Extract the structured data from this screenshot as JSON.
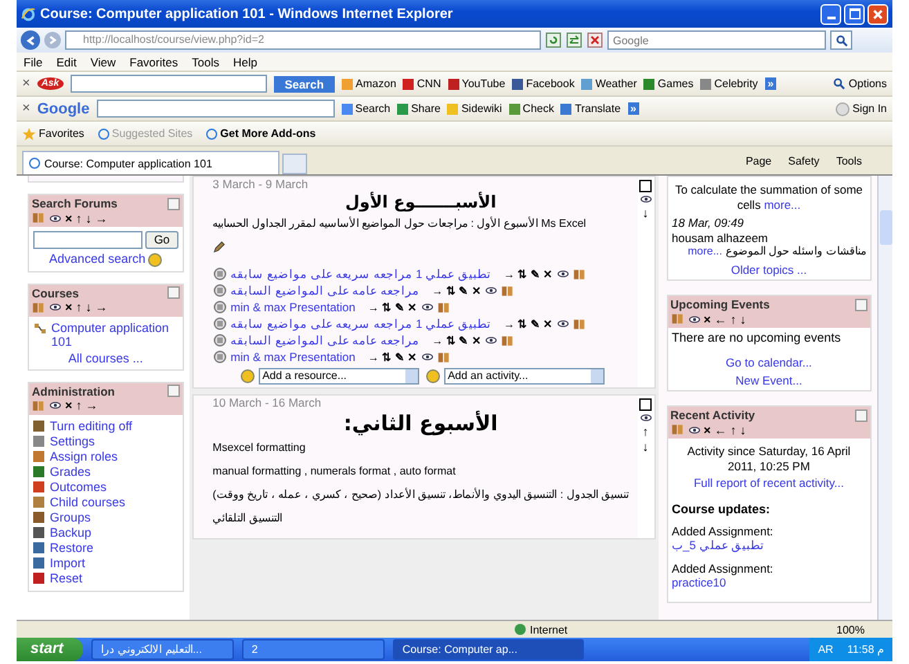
{
  "window": {
    "title": "Course: Computer application 101 - Windows Internet Explorer"
  },
  "address_bar": {
    "url": "http://localhost/course/view.php?id=2",
    "search_placeholder": "Google"
  },
  "menu": [
    "File",
    "Edit",
    "View",
    "Favorites",
    "Tools",
    "Help"
  ],
  "ask_toolbar": {
    "close": "×",
    "logo": "Ask",
    "search_button": "Search",
    "links": [
      "Amazon",
      "CNN",
      "YouTube",
      "Facebook",
      "Weather",
      "Games",
      "Celebrity"
    ],
    "more": "»",
    "options": "Options"
  },
  "google_toolbar": {
    "close": "×",
    "logo": "Google",
    "items": [
      "Search",
      "Share",
      "Sidewiki",
      "Check",
      "Translate"
    ],
    "more": "»",
    "sign_in": "Sign In"
  },
  "favorites_bar": {
    "favorites": "Favorites",
    "items": [
      {
        "label": "Suggested Sites",
        "disabled": true,
        "emphasis": false
      },
      {
        "label": "Get More Add-ons",
        "disabled": false,
        "emphasis": true
      }
    ]
  },
  "tab": {
    "title": "Course: Computer application 101",
    "selected": true
  },
  "command_bar": [
    "Page",
    "Safety",
    "Tools"
  ],
  "left_blocks": [
    {
      "title": "Search Forums",
      "kind": "search",
      "controls": "× ↑ ↓ →",
      "button": "Go",
      "link": "Advanced search"
    },
    {
      "title": "Courses",
      "kind": "courses",
      "controls": "× ↑ ↓ →",
      "items": [
        "Computer application 101"
      ],
      "footer": "All courses ..."
    },
    {
      "title": "Administration",
      "kind": "admin",
      "controls": "× ↑ →",
      "items": [
        "Turn editing off",
        "Settings",
        "Assign roles",
        "Grades",
        "Outcomes",
        "Child courses",
        "Groups",
        "Backup",
        "Restore",
        "Import",
        "Reset"
      ]
    }
  ],
  "sections": [
    {
      "dates": "3 March - 9 March",
      "heading": "الأسبـــــــوع الأول",
      "lines": [
        "الأسبوع الأول : مراجعات حول المواضيع الأساسيه لمقرر الجداول الحسابيه Ms Excel"
      ],
      "side_controls": "↓",
      "resources": [
        {
          "title": "تطبيق عملي 1 مراجعه سريعه على مواضيع سابقه",
          "controls": "→ ⇅ ✎ ✕"
        },
        {
          "title": "مراجعه عامه على المواضيع السابقه",
          "controls": "→ ⇅ ✎ ✕"
        },
        {
          "title": "min & max Presentation",
          "controls": "→ ⇅ ✎ ✕"
        },
        {
          "title": "تطبيق عملي 1 مراجعه سريعه على مواضيع سابقه",
          "controls": "→ ⇅ ✎ ✕"
        },
        {
          "title": "مراجعه عامه على المواضيع السابقه",
          "controls": "→ ⇅ ✎ ✕"
        },
        {
          "title": "min & max Presentation",
          "controls": "→ ⇅ ✎ ✕"
        }
      ],
      "add_resource": "Add a resource...",
      "add_activity": "Add an activity..."
    },
    {
      "dates": "10 March - 16 March",
      "heading": "الأسبوع الثاني:",
      "lines": [
        "Msexcel formatting",
        "manual formatting , numerals format , auto format",
        "تنسيق الجدول : التنسيق اليدوي والأنماط، تنسيق الأعداد (صحيح ، كسري ، عمله ، تاريخ ووقت)",
        "التنسيق التلقائي"
      ],
      "side_controls": "↑ ↓"
    }
  ],
  "forum_block": {
    "text": "To calculate the summation of some cells",
    "more": "more...",
    "date": "18 Mar, 09:49",
    "author": "housam alhazeem",
    "post": "مناقشات واسئله حول الموضوع",
    "post_more": "more...",
    "older": "Older topics ..."
  },
  "right_blocks": [
    {
      "title": "Upcoming Events",
      "kind": "events",
      "controls": "× ← ↑ ↓",
      "text": "There are no upcoming events",
      "links": [
        "Go to calendar...",
        "New Event..."
      ]
    },
    {
      "title": "Recent Activity",
      "kind": "activity",
      "controls": "× ← ↑ ↓",
      "text": "Activity since Saturday, 16 April 2011, 10:25 PM",
      "link": "Full report of recent activity...",
      "subheading": "Course updates:",
      "updates": [
        {
          "label": "Added Assignment:",
          "link": "تطبيق عملي 5_ب"
        },
        {
          "label": "Added Assignment:",
          "link": "practice10"
        }
      ]
    }
  ],
  "status_bar": {
    "zone": "Internet",
    "zoom": "100%"
  },
  "taskbar": {
    "start": "start",
    "tasks": [
      {
        "label": "التعليم الالكتروني درا...",
        "selected": false
      },
      {
        "label": "2",
        "selected": false
      },
      {
        "label": "Course: Computer ap...",
        "selected": true
      }
    ],
    "language": "AR",
    "clock": "11:58 م"
  }
}
